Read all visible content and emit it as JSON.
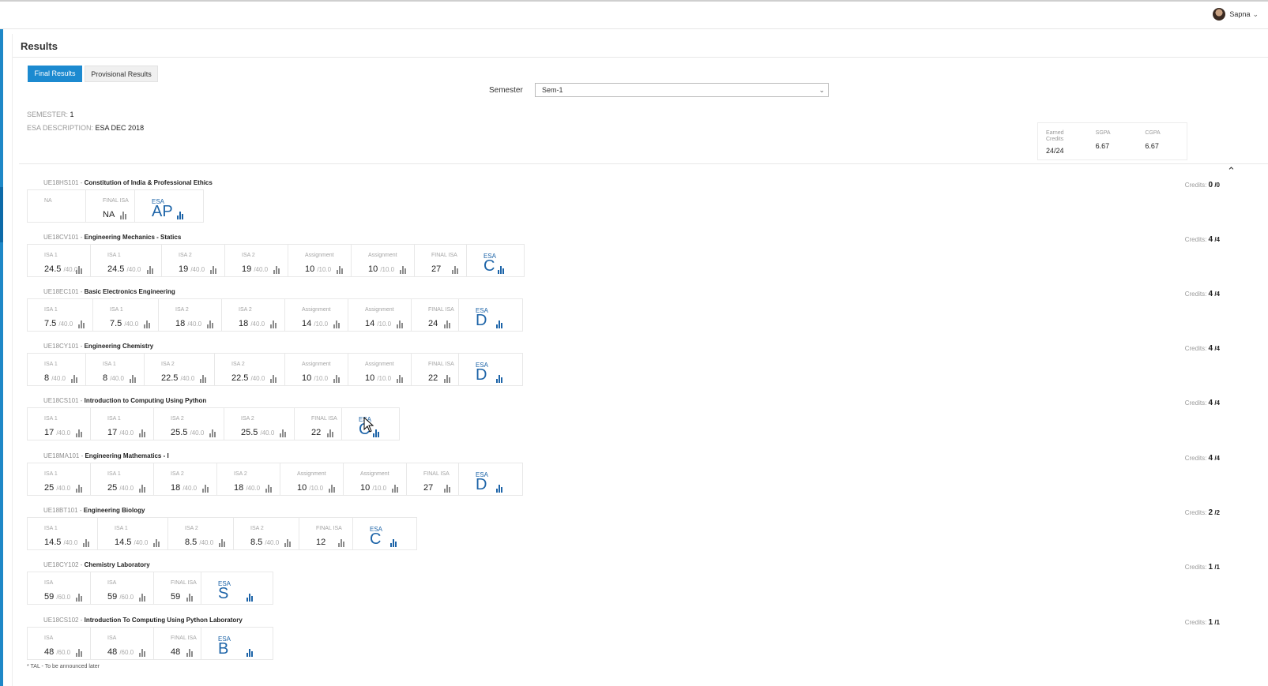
{
  "user": {
    "name": "Sapna"
  },
  "page": {
    "title": "Results"
  },
  "tabs": [
    {
      "label": "Final Results",
      "active": true
    },
    {
      "label": "Provisional Results",
      "active": false
    }
  ],
  "semester": {
    "label": "Semester",
    "selected": "Sem-1"
  },
  "meta": {
    "semester_label": "SEMESTER:",
    "semester_value": "1",
    "esa_label": "ESA DESCRIPTION:",
    "esa_value": "ESA DEC 2018"
  },
  "summary": {
    "earned_label": "Earned Credits",
    "earned_value": "24/24",
    "sgpa_label": "SGPA",
    "sgpa_value": "6.67",
    "cgpa_label": "CGPA",
    "cgpa_value": "6.67"
  },
  "courses": [
    {
      "code": "UE18HS101",
      "name": "Constitution of India & Professional Ethics",
      "credits_label": "Credits:",
      "credits_earned": "0",
      "credits_total": "/0",
      "cells": [
        {
          "type": "na",
          "label": "NA"
        },
        {
          "label": "FINAL ISA",
          "value": "NA",
          "den": ""
        },
        {
          "type": "esa",
          "label": "ESA",
          "grade": "AP"
        }
      ]
    },
    {
      "code": "UE18CV101",
      "name": "Engineering Mechanics - Statics",
      "credits_label": "Credits:",
      "credits_earned": "4",
      "credits_total": "/4",
      "cells": [
        {
          "label": "ISA 1",
          "value": "24.5",
          "den": "/40.0"
        },
        {
          "label": "ISA 1",
          "value": "24.5",
          "den": "/40.0"
        },
        {
          "label": "ISA 2",
          "value": "19",
          "den": "/40.0"
        },
        {
          "label": "ISA 2",
          "value": "19",
          "den": "/40.0"
        },
        {
          "label": "Assignment",
          "value": "10",
          "den": "/10.0"
        },
        {
          "label": "Assignment",
          "value": "10",
          "den": "/10.0"
        },
        {
          "label": "FINAL ISA",
          "value": "27",
          "den": ""
        },
        {
          "type": "esa",
          "label": "ESA",
          "grade": "C"
        }
      ]
    },
    {
      "code": "UE18EC101",
      "name": "Basic Electronics Engineering",
      "credits_label": "Credits:",
      "credits_earned": "4",
      "credits_total": "/4",
      "cells": [
        {
          "label": "ISA 1",
          "value": "7.5",
          "den": "/40.0"
        },
        {
          "label": "ISA 1",
          "value": "7.5",
          "den": "/40.0"
        },
        {
          "label": "ISA 2",
          "value": "18",
          "den": "/40.0"
        },
        {
          "label": "ISA 2",
          "value": "18",
          "den": "/40.0"
        },
        {
          "label": "Assignment",
          "value": "14",
          "den": "/10.0"
        },
        {
          "label": "Assignment",
          "value": "14",
          "den": "/10.0"
        },
        {
          "label": "FINAL ISA",
          "value": "24",
          "den": ""
        },
        {
          "type": "esa",
          "label": "ESA",
          "grade": "D"
        }
      ]
    },
    {
      "code": "UE18CY101",
      "name": "Engineering Chemistry",
      "credits_label": "Credits:",
      "credits_earned": "4",
      "credits_total": "/4",
      "cells": [
        {
          "label": "ISA 1",
          "value": "8",
          "den": "/40.0"
        },
        {
          "label": "ISA 1",
          "value": "8",
          "den": "/40.0"
        },
        {
          "label": "ISA 2",
          "value": "22.5",
          "den": "/40.0"
        },
        {
          "label": "ISA 2",
          "value": "22.5",
          "den": "/40.0"
        },
        {
          "label": "Assignment",
          "value": "10",
          "den": "/10.0"
        },
        {
          "label": "Assignment",
          "value": "10",
          "den": "/10.0"
        },
        {
          "label": "FINAL ISA",
          "value": "22",
          "den": ""
        },
        {
          "type": "esa",
          "label": "ESA",
          "grade": "D"
        }
      ]
    },
    {
      "code": "UE18CS101",
      "name": "Introduction to Computing Using Python",
      "credits_label": "Credits:",
      "credits_earned": "4",
      "credits_total": "/4",
      "cells": [
        {
          "label": "ISA 1",
          "value": "17",
          "den": "/40.0"
        },
        {
          "label": "ISA 1",
          "value": "17",
          "den": "/40.0"
        },
        {
          "label": "ISA 2",
          "value": "25.5",
          "den": "/40.0"
        },
        {
          "label": "ISA 2",
          "value": "25.5",
          "den": "/40.0"
        },
        {
          "label": "FINAL ISA",
          "value": "22",
          "den": ""
        },
        {
          "type": "esa",
          "label": "ESA",
          "grade": "C"
        }
      ]
    },
    {
      "code": "UE18MA101",
      "name": "Engineering Mathematics - I",
      "credits_label": "Credits:",
      "credits_earned": "4",
      "credits_total": "/4",
      "cells": [
        {
          "label": "ISA 1",
          "value": "25",
          "den": "/40.0"
        },
        {
          "label": "ISA 1",
          "value": "25",
          "den": "/40.0"
        },
        {
          "label": "ISA 2",
          "value": "18",
          "den": "/40.0"
        },
        {
          "label": "ISA 2",
          "value": "18",
          "den": "/40.0"
        },
        {
          "label": "Assignment",
          "value": "10",
          "den": "/10.0"
        },
        {
          "label": "Assignment",
          "value": "10",
          "den": "/10.0"
        },
        {
          "label": "FINAL ISA",
          "value": "27",
          "den": ""
        },
        {
          "type": "esa",
          "label": "ESA",
          "grade": "D"
        }
      ]
    },
    {
      "code": "UE18BT101",
      "name": "Engineering Biology",
      "credits_label": "Credits:",
      "credits_earned": "2",
      "credits_total": "/2",
      "cells": [
        {
          "label": "ISA 1",
          "value": "14.5",
          "den": "/40.0"
        },
        {
          "label": "ISA 1",
          "value": "14.5",
          "den": "/40.0"
        },
        {
          "label": "ISA 2",
          "value": "8.5",
          "den": "/40.0"
        },
        {
          "label": "ISA 2",
          "value": "8.5",
          "den": "/40.0"
        },
        {
          "label": "FINAL ISA",
          "value": "12",
          "den": ""
        },
        {
          "type": "esa",
          "label": "ESA",
          "grade": "C"
        }
      ]
    },
    {
      "code": "UE18CY102",
      "name": "Chemistry Laboratory",
      "credits_label": "Credits:",
      "credits_earned": "1",
      "credits_total": "/1",
      "cells": [
        {
          "label": "ISA",
          "value": "59",
          "den": "/60.0"
        },
        {
          "label": "ISA",
          "value": "59",
          "den": "/60.0"
        },
        {
          "label": "FINAL ISA",
          "value": "59",
          "den": ""
        },
        {
          "type": "esa",
          "label": "ESA",
          "grade": "S"
        }
      ]
    },
    {
      "code": "UE18CS102",
      "name": "Introduction To Computing Using Python Laboratory",
      "credits_label": "Credits:",
      "credits_earned": "1",
      "credits_total": "/1",
      "cells": [
        {
          "label": "ISA",
          "value": "48",
          "den": "/60.0"
        },
        {
          "label": "ISA",
          "value": "48",
          "den": "/60.0"
        },
        {
          "label": "FINAL ISA",
          "value": "48",
          "den": ""
        },
        {
          "type": "esa",
          "label": "ESA",
          "grade": "B"
        }
      ]
    }
  ],
  "footnote": "* TAL - To be announced later"
}
